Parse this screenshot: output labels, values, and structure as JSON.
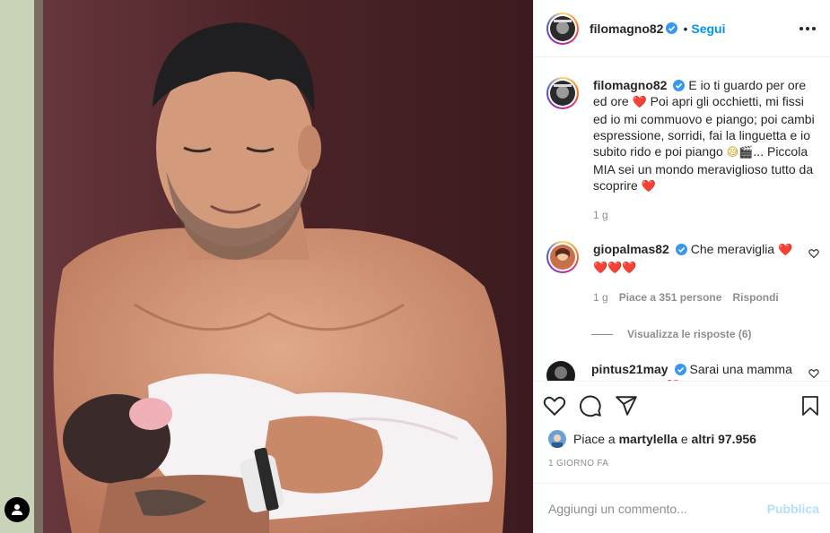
{
  "post": {
    "author": "filomagno82",
    "follow_label": "Segui",
    "dot": "•",
    "caption": {
      "username": "filomagno82",
      "text_part1": "E io ti guardo per ore ed ore",
      "emoji1": "❤️",
      "text_part2": "Poi apri gli occhietti, mi fissi ed io mi commuovo e piango; poi cambi espressione, sorridi, fai la linguetta e io subito rido e poi piango",
      "emoji2": "😅🎬",
      "text_part3": "... Piccola MIA sei un mondo meraviglioso tutto da scoprire",
      "emoji3": "❤️",
      "time": "1 g"
    },
    "comments": [
      {
        "username": "giopalmas82",
        "text": "Che meraviglia",
        "emoji": "❤️❤️❤️❤️",
        "time": "1 g",
        "likes": "Piace a 351 persone",
        "reply": "Rispondi"
      },
      {
        "username": "pintus21may",
        "text": "Sarai una mamma meravigliosa",
        "emoji": "💖"
      }
    ],
    "view_replies": "Visualizza le risposte (6)",
    "likes_prefix": "Piace a",
    "likes_user": "martylella",
    "likes_connector": "e",
    "likes_others": "altri 97.956",
    "date": "1 giorno fa",
    "add_comment_placeholder": "Aggiungi un commento...",
    "publish_label": "Pubblica"
  },
  "icons": {
    "more": "more-options-icon",
    "verified": "verified-badge-icon",
    "like": "heart-icon",
    "comment": "comment-icon",
    "share": "share-icon",
    "save": "bookmark-icon",
    "tags": "user-tag-icon"
  },
  "colors": {
    "link_blue": "#0095f6",
    "publish_disabled": "#b2dffc",
    "muted": "#8e8e8e",
    "text": "#262626"
  }
}
